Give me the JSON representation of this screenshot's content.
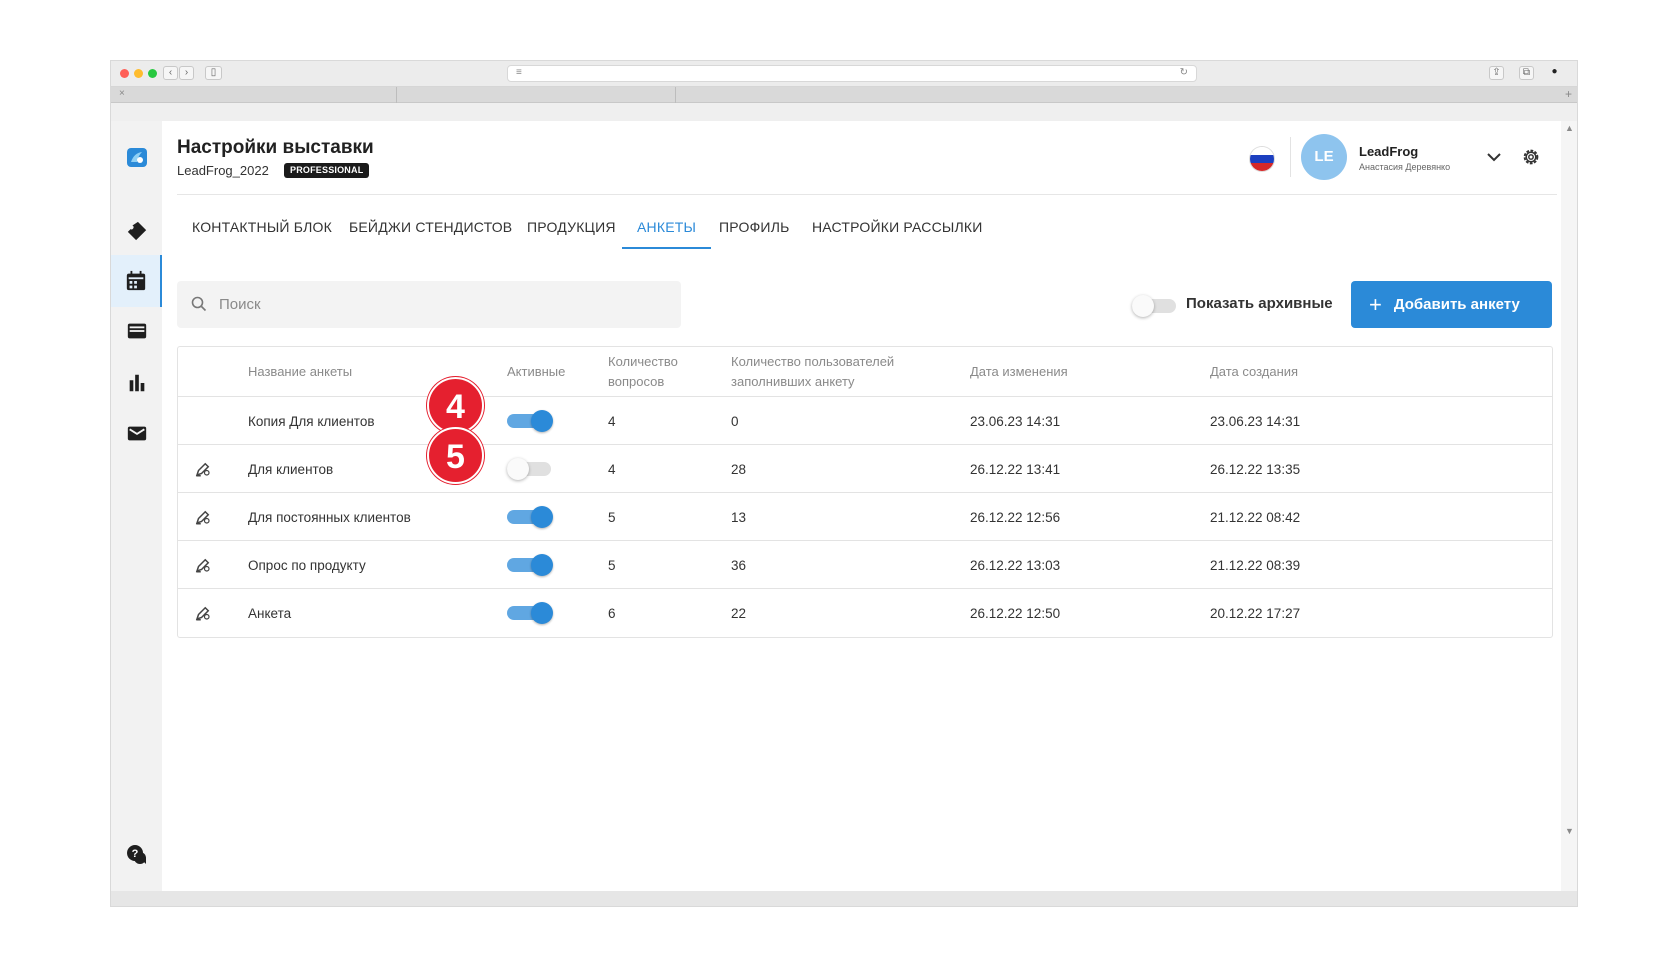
{
  "app": {
    "title": "Настройки выставки",
    "event_name": "LeadFrog_2022",
    "plan_badge": "PROFESSIONAL",
    "language_flag": "flag-russia-icon",
    "user": {
      "initials": "LE",
      "name": "LeadFrog",
      "subtitle": "Анастасия Деревянко"
    }
  },
  "tabs": [
    {
      "label": "КОНТАКТНЫЙ БЛОК",
      "active": false
    },
    {
      "label": "БЕЙДЖИ СТЕНДИСТОВ",
      "active": false
    },
    {
      "label": "ПРОДУКЦИЯ",
      "active": false
    },
    {
      "label": "АНКЕТЫ",
      "active": true
    },
    {
      "label": "ПРОФИЛЬ",
      "active": false
    },
    {
      "label": "НАСТРОЙКИ РАССЫЛКИ",
      "active": false
    }
  ],
  "toolbar": {
    "search_placeholder": "Поиск",
    "show_archived_label": "Показать архивные",
    "show_archived_on": false,
    "add_button_label": "Добавить анкету",
    "add_button_icon": "plus-icon"
  },
  "table": {
    "headers": {
      "name": "Название анкеты",
      "active": "Активные",
      "questions_line1": "Количество",
      "questions_line2": "вопросов",
      "users_line1": "Количество пользователей",
      "users_line2": "заполнивших анкету",
      "modified": "Дата изменения",
      "created": "Дата создания"
    },
    "rows": [
      {
        "has_icon": false,
        "name": "Копия Для клиентов",
        "active": true,
        "questions": "4",
        "users": "0",
        "modified": "23.06.23 14:31",
        "created": "23.06.23 14:31"
      },
      {
        "has_icon": true,
        "name": "Для клиентов",
        "active": false,
        "questions": "4",
        "users": "28",
        "modified": "26.12.22 13:41",
        "created": "26.12.22 13:35"
      },
      {
        "has_icon": true,
        "name": "Для постоянных клиентов",
        "active": true,
        "questions": "5",
        "users": "13",
        "modified": "26.12.22 12:56",
        "created": "21.12.22 08:42"
      },
      {
        "has_icon": true,
        "name": "Опрос по продукту",
        "active": true,
        "questions": "5",
        "users": "36",
        "modified": "26.12.22 13:03",
        "created": "21.12.22 08:39"
      },
      {
        "has_icon": true,
        "name": "Анкета",
        "active": true,
        "questions": "6",
        "users": "22",
        "modified": "26.12.22 12:50",
        "created": "20.12.22 17:27"
      }
    ]
  },
  "markers": [
    "4",
    "5"
  ],
  "colors": {
    "accent": "#2b8ad8",
    "marker": "#e5202f",
    "avatar": "#8ec4ee"
  }
}
